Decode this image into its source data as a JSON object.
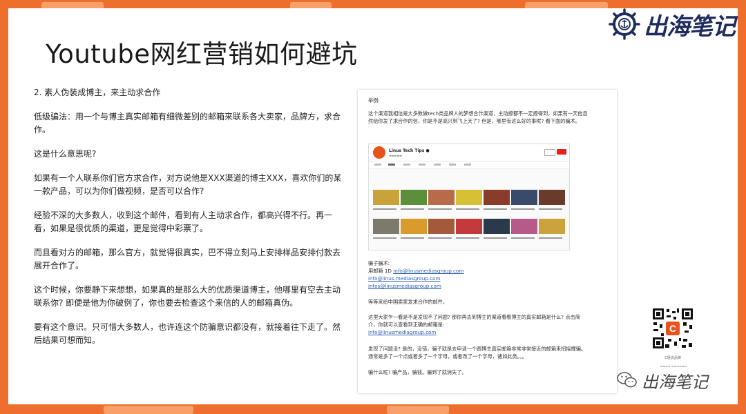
{
  "brand": {
    "name": "出海笔记"
  },
  "slide": {
    "title": "Youtube网红营销如何避坑"
  },
  "left": {
    "paragraphs": [
      "2. 素人伪装成博主，来主动求合作",
      "低级骗法：用一个与博主真实邮箱有细微差别的邮箱来联系各大卖家，品牌方，求合作。",
      "这是什么意思呢?",
      "如果有一个人联系你们官方求合作，对方说他是XXX渠道的博主XXX，喜欢你们的某一款产品，可以为你们做视频，是否可以合作?",
      "经验不深的大多数人，收到这个邮件，看到有人主动求合作，都高兴得不行。再一看，如果是很优质的渠道，更是觉得中彩票了。",
      "而且看对方的邮箱，那么官方，就觉得很真实，巴不得立刻马上安排样品安排付款去展开合作了。",
      "这个时候，你要静下来想想，如果真的是那么大的优质渠道博主，他哪里有空去主动联系你? 即便是他为你破例了，你也要去检查这个来信的人的邮箱真伪。",
      "要有这个意识。只可惜大多数人，也许连这个防骗意识都没有，就接着往下走了。然后结果可想而知。"
    ]
  },
  "right": {
    "example_label": "举例:",
    "intro": "这个渠道我相信是大多数做tech类品牌人的梦想合作渠道，主动撩都不一定撩得到，如果有一天他忽然给你发了求合作的信，你是不是高兴到飞上天了? 但是，哪里有这么好的事呢? 看下面的骗术。",
    "channel_name": "Linus Tech Tips ●",
    "scam_label": "骗子骗术:",
    "email_prefix": "用邮箱 1D",
    "email1": "info@linusmediasgroup.com",
    "email2": "info@linus.mediasgroup.com",
    "email3": "infos@linusmediasgroup.com",
    "wait_text": "等等来给中国卖家发求合作的邮件。",
    "question": "这里大家乍一看是不是发现不了问题? 那你再去到博主的渠道看看博主的真实邮箱是什么? 点击简介，你就可以查看到正确的邮箱是:",
    "correct_email": "info@linusmediagroup.com",
    "found": "发现了问题没? 是的，没错，骗子就是去申请一个跟博主真实邮箱非常非常接近的邮箱来招摇撞骗。通常是多了一个点或者多了一个字母，或者改了一个字母，诸如此类。。。",
    "conclusion": "骗什么呢? 骗产品，骗钱。骗到了就消失了。"
  },
  "qr": {
    "caption": "C姐说品牌"
  },
  "colors": {
    "frame": "#ee6f2d",
    "link": "#2a5db0",
    "brand": "#1f2c5e"
  }
}
